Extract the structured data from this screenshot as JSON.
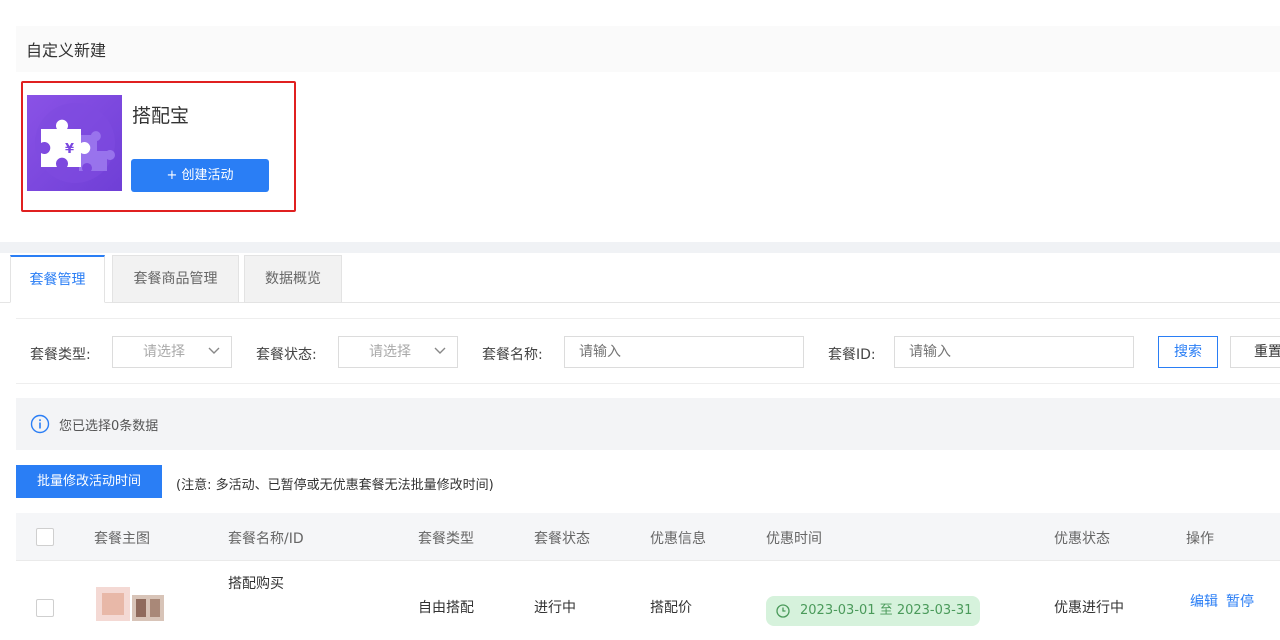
{
  "custom_section": {
    "title": "自定义新建",
    "card": {
      "name": "搭配宝",
      "create_label": "+ 创建活动",
      "icon": "puzzle-yuan-icon"
    }
  },
  "tabs": [
    {
      "label": "套餐管理",
      "active": true
    },
    {
      "label": "套餐商品管理",
      "active": false
    },
    {
      "label": "数据概览",
      "active": false
    }
  ],
  "filters": {
    "type_label": "套餐类型:",
    "type_placeholder": "请选择",
    "status_label": "套餐状态:",
    "status_placeholder": "请选择",
    "name_label": "套餐名称:",
    "name_placeholder": "请输入",
    "id_label": "套餐ID:",
    "id_placeholder": "请输入",
    "search_label": "搜索",
    "reset_label": "重置"
  },
  "info": {
    "selected_text": "您已选择0条数据"
  },
  "batch": {
    "button_label": "批量修改活动时间",
    "note": "(注意: 多活动、已暂停或无优惠套餐无法批量修改时间)"
  },
  "table": {
    "columns": [
      "套餐主图",
      "套餐名称/ID",
      "套餐类型",
      "套餐状态",
      "优惠信息",
      "优惠时间",
      "优惠状态",
      "操作"
    ],
    "rows": [
      {
        "name": "搭配购买",
        "type": "自由搭配",
        "status": "进行中",
        "discount": "搭配价",
        "time": "2023-03-01 至 2023-03-31",
        "discount_status": "优惠进行中",
        "actions": [
          "编辑",
          "暂停"
        ]
      }
    ]
  },
  "colors": {
    "primary": "#2a7ef5",
    "highlight_border": "#e02020",
    "card_bg": "#7a47e0",
    "pill_bg": "#d6f2dc"
  }
}
